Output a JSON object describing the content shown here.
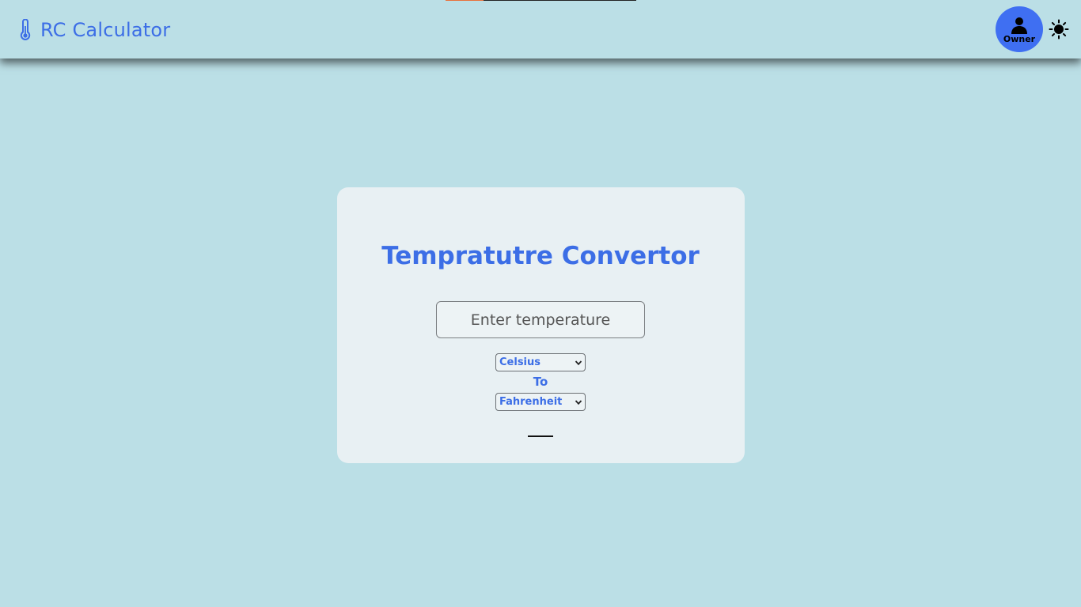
{
  "navbar": {
    "progress_fraction": 0.2,
    "brand_icon": "thermometer-icon",
    "brand_title": "RC Calculator",
    "owner_icon": "user-icon",
    "owner_label": "Owner",
    "theme_icon": "sun-icon"
  },
  "converter": {
    "title": "Tempratutre Convertor",
    "input_placeholder": "Enter temperature",
    "input_value": "",
    "from_unit": "Celsius",
    "to_label": "To",
    "to_unit": "Fahrenheit",
    "dropdown_icon": "chevron-down-icon"
  },
  "colors": {
    "background": "#bbdfe6",
    "accent": "#3c6ee6",
    "owner_badge": "#3f6ff2",
    "card": "#e8f0f3",
    "progress": "#e8703a"
  }
}
